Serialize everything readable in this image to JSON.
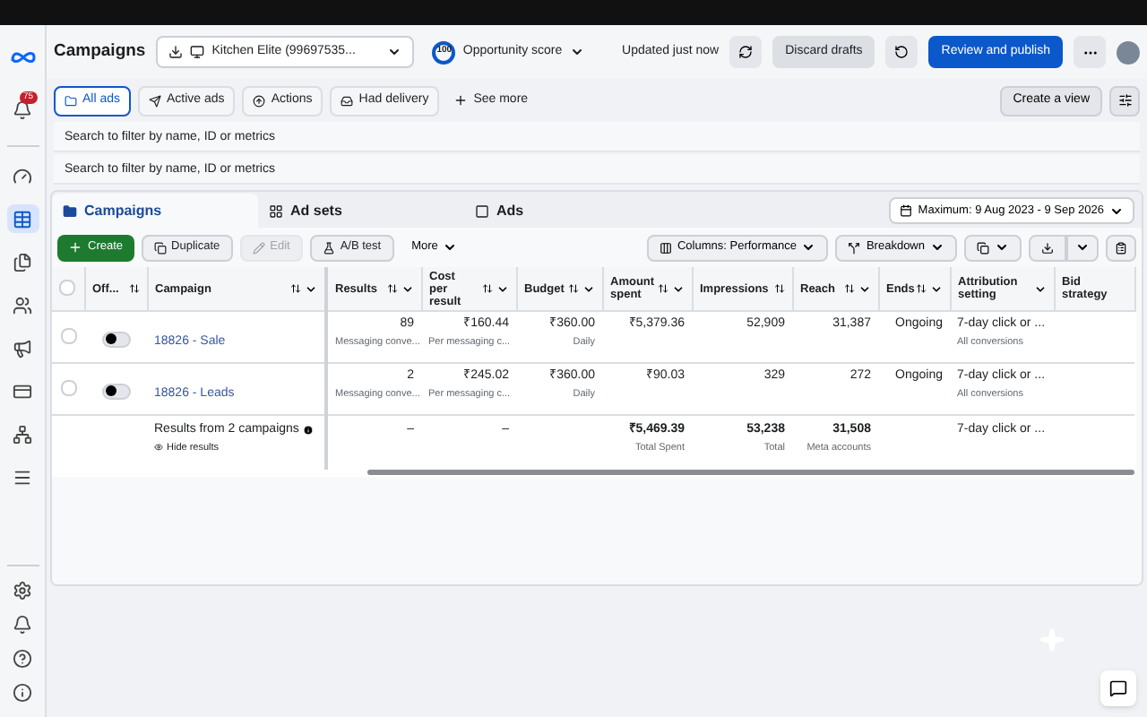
{
  "header": {
    "title": "Campaigns",
    "account": "Kitchen Elite (99697535...",
    "score_badge": "100",
    "score_label": "Opportunity score",
    "updated": "Updated just now",
    "discard": "Discard drafts",
    "publish": "Review and publish"
  },
  "sidebar": {
    "notification_badge": "75",
    "items": [
      {
        "selected": false
      },
      {
        "selected": true
      },
      {
        "selected": false
      },
      {
        "selected": false
      },
      {
        "selected": false
      },
      {
        "selected": false
      },
      {
        "selected": false
      },
      {
        "selected": false
      }
    ]
  },
  "filters": [
    {
      "label": "All ads",
      "selected": true
    },
    {
      "label": "Active ads",
      "selected": false
    },
    {
      "label": "Actions",
      "selected": false
    },
    {
      "label": "Had delivery",
      "selected": false
    }
  ],
  "see_more": "See more",
  "create_view": "Create a view",
  "search_fields": [
    {
      "placeholder": "Search to filter by name, ID or metrics"
    },
    {
      "placeholder": "Search to filter by name, ID or metrics"
    }
  ],
  "tabs": [
    {
      "label": "Campaigns",
      "selected": true
    },
    {
      "label": "Ad sets",
      "selected": false
    },
    {
      "label": "Ads",
      "selected": false
    }
  ],
  "date_range": "Maximum: 9 Aug 2023 - 9 Sep 2026",
  "toolbar": {
    "create": "Create",
    "actions": [
      {
        "label": "Duplicate",
        "disabled": false
      },
      {
        "label": "Edit",
        "disabled": true
      },
      {
        "label": "A/B test",
        "disabled": false
      }
    ],
    "more": "More",
    "columns": "Columns: Performance",
    "breakdown": "Breakdown"
  },
  "table": {
    "all_checked": false,
    "columns": [
      {
        "label": "Off...",
        "kind": "toggle",
        "sort": true,
        "menu": false
      },
      {
        "label": "Campaign",
        "kind": "name",
        "sort": true,
        "menu": true
      },
      {
        "label": "Results",
        "kind": "number",
        "sort": true,
        "menu": true
      },
      {
        "label": "Cost per result",
        "kind": "number",
        "sort": true,
        "menu": true
      },
      {
        "label": "Budget",
        "kind": "number",
        "sort": true,
        "menu": true
      },
      {
        "label": "Amount spent",
        "kind": "number",
        "sort": true,
        "menu": true
      },
      {
        "label": "Impressions",
        "kind": "number",
        "sort": true,
        "menu": false
      },
      {
        "label": "Reach",
        "kind": "number",
        "sort": true,
        "menu": true
      },
      {
        "label": "Ends",
        "kind": "number",
        "sort": true,
        "menu": true
      },
      {
        "label": "Attribution setting",
        "kind": "text",
        "sort": false,
        "menu": true
      },
      {
        "label": "Bid strategy",
        "kind": "text",
        "sort": false,
        "menu": false
      }
    ],
    "rows": [
      {
        "checked": false,
        "on": false,
        "cells": [
          {
            "text": ""
          },
          {
            "text": "18826 - Sale"
          },
          {
            "text": "89",
            "sub": "Messaging conve..."
          },
          {
            "text": "₹160.44",
            "sub": "Per messaging c..."
          },
          {
            "text": "₹360.00",
            "sub": "Daily"
          },
          {
            "text": "₹5,379.36"
          },
          {
            "text": "52,909"
          },
          {
            "text": "31,387"
          },
          {
            "text": "Ongoing"
          },
          {
            "text": "7-day click or ...",
            "sub": "All conversions"
          },
          {
            "text": ""
          }
        ]
      },
      {
        "checked": false,
        "on": false,
        "cells": [
          {
            "text": ""
          },
          {
            "text": "18826 - Leads"
          },
          {
            "text": "2",
            "sub": "Messaging conve..."
          },
          {
            "text": "₹245.02",
            "sub": "Per messaging c..."
          },
          {
            "text": "₹360.00",
            "sub": "Daily"
          },
          {
            "text": "₹90.03"
          },
          {
            "text": "329"
          },
          {
            "text": "272"
          },
          {
            "text": "Ongoing"
          },
          {
            "text": "7-day click or ...",
            "sub": "All conversions"
          },
          {
            "text": ""
          }
        ]
      }
    ],
    "summary": {
      "cells": [
        {
          "text": ""
        },
        {
          "text": "Results from 2 campaigns",
          "sub": "Hide results"
        },
        {
          "text": "–"
        },
        {
          "text": "–"
        },
        {
          "text": ""
        },
        {
          "text": "₹5,469.39",
          "sub": "Total Spent"
        },
        {
          "text": "53,238",
          "sub": "Total"
        },
        {
          "text": "31,508",
          "sub": "Meta accounts"
        },
        {
          "text": ""
        },
        {
          "text": "7-day click or ..."
        },
        {
          "text": ""
        }
      ]
    }
  }
}
